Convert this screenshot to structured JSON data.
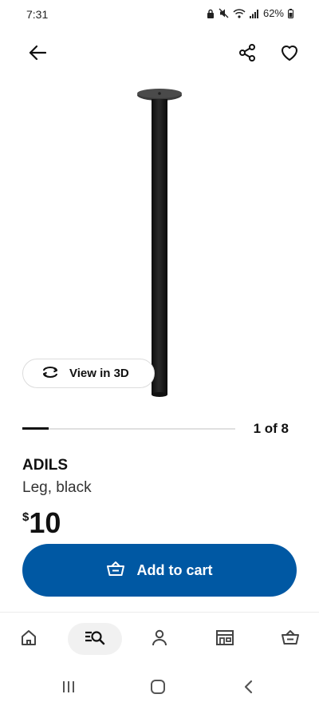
{
  "status_bar": {
    "time": "7:31",
    "battery": "62%"
  },
  "product": {
    "name": "ADILS",
    "description": "Leg, black",
    "price_currency": "$",
    "price_value": "10"
  },
  "gallery": {
    "view3d_label": "View in 3D",
    "counter": "1 of 8",
    "current_index": 1,
    "total": 8
  },
  "actions": {
    "add_to_cart_label": "Add to cart"
  },
  "bottom_nav": {
    "items": [
      "home-icon",
      "search-list-icon",
      "profile-icon",
      "store-icon",
      "cart-icon"
    ],
    "active": "search-list-icon"
  },
  "colors": {
    "primary": "#0058a3",
    "text": "#111111"
  }
}
